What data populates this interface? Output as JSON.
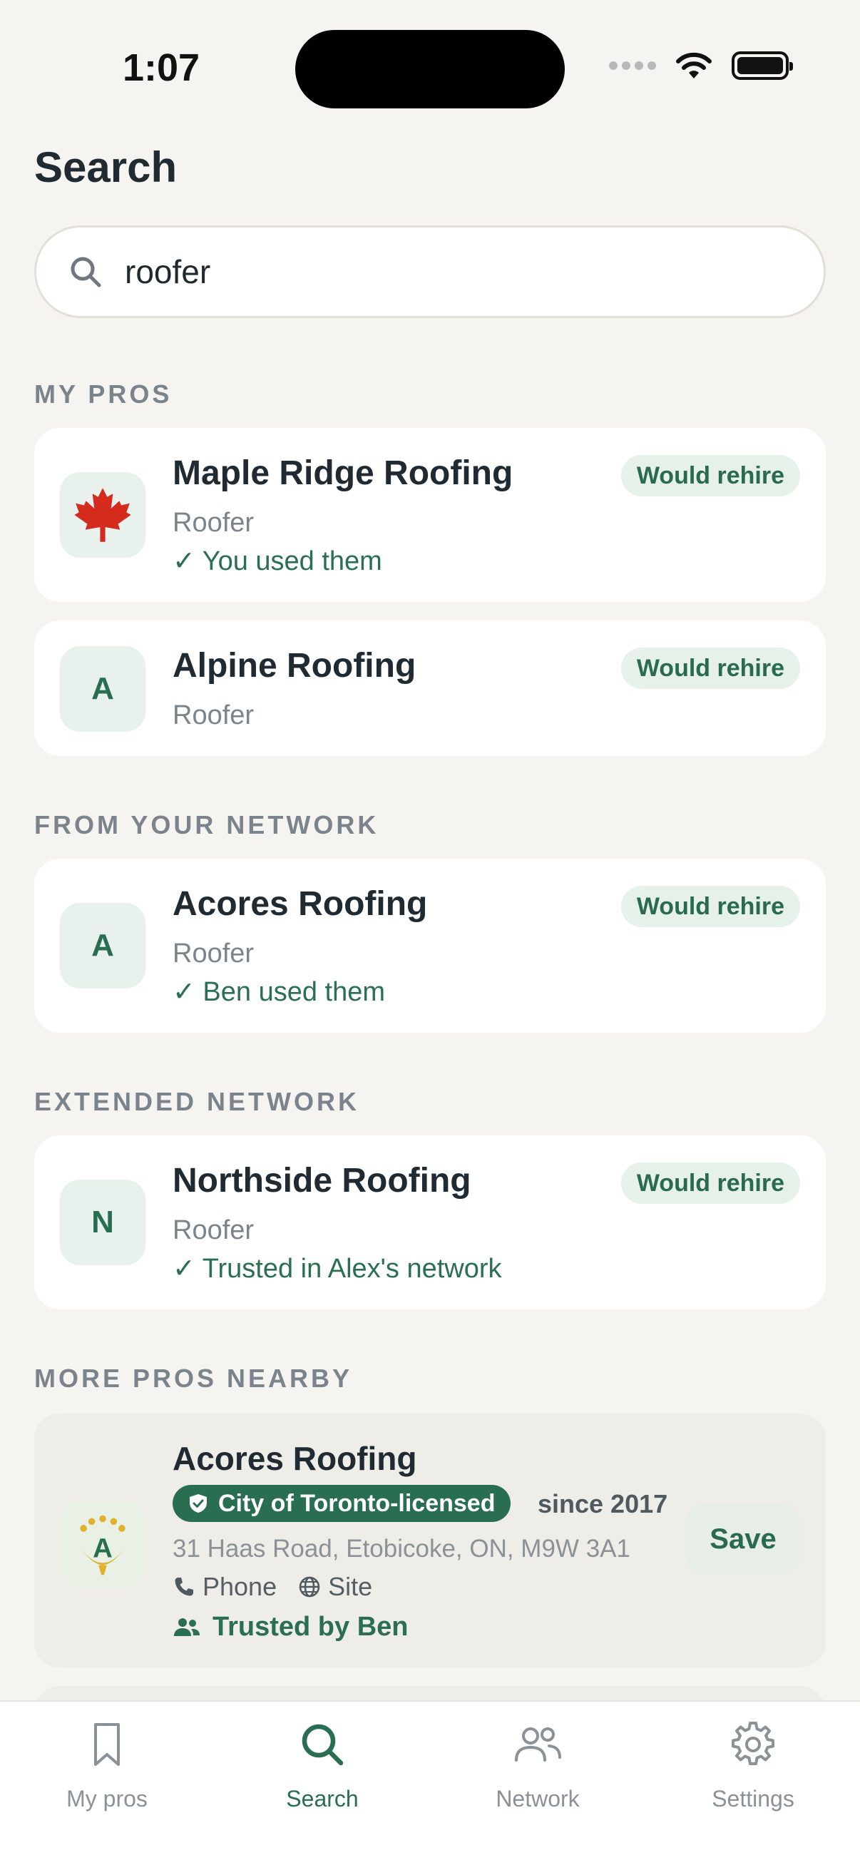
{
  "status_bar": {
    "time": "1:07"
  },
  "page": {
    "title": "Search"
  },
  "search": {
    "value": "roofer"
  },
  "sections": {
    "my_pros": "MY PROS",
    "from_network": "FROM YOUR NETWORK",
    "extended": "EXTENDED NETWORK",
    "nearby": "MORE PROS NEARBY"
  },
  "my_pros": [
    {
      "name": "Maple Ridge Roofing",
      "type": "Roofer",
      "note": "✓ You used them",
      "badge": "Would rehire",
      "avatar_icon": "maple-leaf-icon"
    },
    {
      "name": "Alpine Roofing",
      "type": "Roofer",
      "badge": "Would rehire",
      "avatar_letter": "A"
    }
  ],
  "network_pros": [
    {
      "name": "Acores Roofing",
      "type": "Roofer",
      "note": "✓ Ben used them",
      "badge": "Would rehire",
      "avatar_letter": "A"
    }
  ],
  "extended_pros": [
    {
      "name": "Northside Roofing",
      "type": "Roofer",
      "note": "✓ Trusted in Alex's network",
      "badge": "Would rehire",
      "avatar_letter": "N"
    }
  ],
  "nearby_pros": [
    {
      "name": "Acores Roofing",
      "license": "City of Toronto-licensed",
      "since": "since 2017",
      "address": "31 Haas Road, Etobicoke, ON, M9W 3A1",
      "phone_label": "Phone",
      "site_label": "Site",
      "trusted": "Trusted by Ben",
      "save_label": "Save",
      "logo_letter": "A"
    }
  ],
  "tabs": [
    {
      "label": "My pros",
      "icon": "bookmark-icon"
    },
    {
      "label": "Search",
      "icon": "search-icon",
      "active": true
    },
    {
      "label": "Network",
      "icon": "people-icon"
    },
    {
      "label": "Settings",
      "icon": "gear-icon"
    }
  ],
  "colors": {
    "accent": "#2a6e52",
    "background": "#f5f4f0",
    "card": "#ffffff",
    "badge_bg": "#e6f1ea"
  }
}
